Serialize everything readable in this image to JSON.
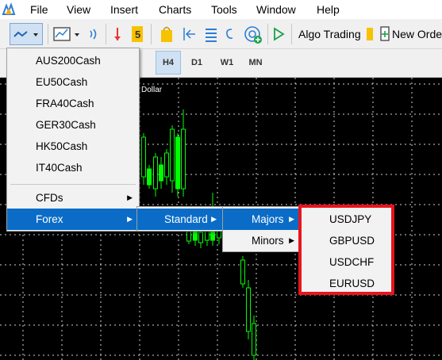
{
  "menubar": {
    "items": [
      {
        "label": "File"
      },
      {
        "label": "View"
      },
      {
        "label": "Insert"
      },
      {
        "label": "Charts"
      },
      {
        "label": "Tools"
      },
      {
        "label": "Window"
      },
      {
        "label": "Help"
      }
    ]
  },
  "toolbar": {
    "algo_trading_label": "Algo Trading",
    "new_order_label": "New Order"
  },
  "timeframes": {
    "items": [
      {
        "label": "H4",
        "active": true
      },
      {
        "label": "D1",
        "active": false
      },
      {
        "label": "W1",
        "active": false
      },
      {
        "label": "MN",
        "active": false
      }
    ]
  },
  "chart": {
    "label": "Dollar"
  },
  "symbols_menu": {
    "items": [
      {
        "label": "AUS200Cash"
      },
      {
        "label": "EU50Cash"
      },
      {
        "label": "FRA40Cash"
      },
      {
        "label": "GER30Cash"
      },
      {
        "label": "HK50Cash"
      },
      {
        "label": "IT40Cash"
      }
    ],
    "groups": [
      {
        "label": "CFDs"
      },
      {
        "label": "Forex"
      }
    ]
  },
  "forex_submenu": {
    "items": [
      {
        "label": "Standard"
      }
    ]
  },
  "standard_submenu": {
    "items": [
      {
        "label": "Majors"
      },
      {
        "label": "Minors"
      }
    ]
  },
  "majors_submenu": {
    "items": [
      {
        "label": "USDJPY"
      },
      {
        "label": "GBPUSD"
      },
      {
        "label": "USDCHF"
      },
      {
        "label": "EURUSD"
      }
    ]
  },
  "colors": {
    "highlight_menu": "#0a6cc7",
    "highlight_box": "#e8141c",
    "candle": "#00ff00",
    "chart_bg": "#000000"
  }
}
